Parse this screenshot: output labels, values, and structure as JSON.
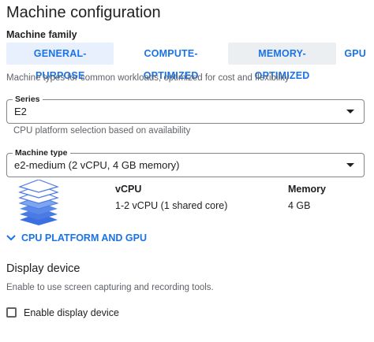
{
  "page": {
    "title": "Machine configuration"
  },
  "machine_family": {
    "label": "Machine family",
    "tabs": [
      {
        "label": "GENERAL-PURPOSE",
        "selected": true
      },
      {
        "label": "COMPUTE-OPTIMIZED",
        "selected": false
      },
      {
        "label": "MEMORY-OPTIMIZED",
        "selected": false
      },
      {
        "label": "GPU",
        "selected": false
      }
    ],
    "description": "Machine types for common workloads, optimized for cost and flexibility"
  },
  "series": {
    "label": "Series",
    "value": "E2",
    "helper": "CPU platform selection based on availability"
  },
  "machine_type": {
    "label": "Machine type",
    "value": "e2-medium (2 vCPU, 4 GB memory)",
    "columns": {
      "vcpu_header": "vCPU",
      "memory_header": "Memory",
      "vcpu_value": "1-2 vCPU (1 shared core)",
      "memory_value": "4 GB"
    }
  },
  "cpu_platform_link": {
    "label": "CPU PLATFORM AND GPU",
    "icon": "chevron-down-icon"
  },
  "display_device": {
    "title": "Display device",
    "description": "Enable to use screen capturing and recording tools.",
    "checkbox_label": "Enable display device",
    "checked": false
  },
  "colors": {
    "accent": "#1a73e8",
    "selected_tab_bg": "#e8f0fe",
    "text": "#202124",
    "muted": "#5f6368",
    "stack_icon_fill": "#4a7be5"
  }
}
